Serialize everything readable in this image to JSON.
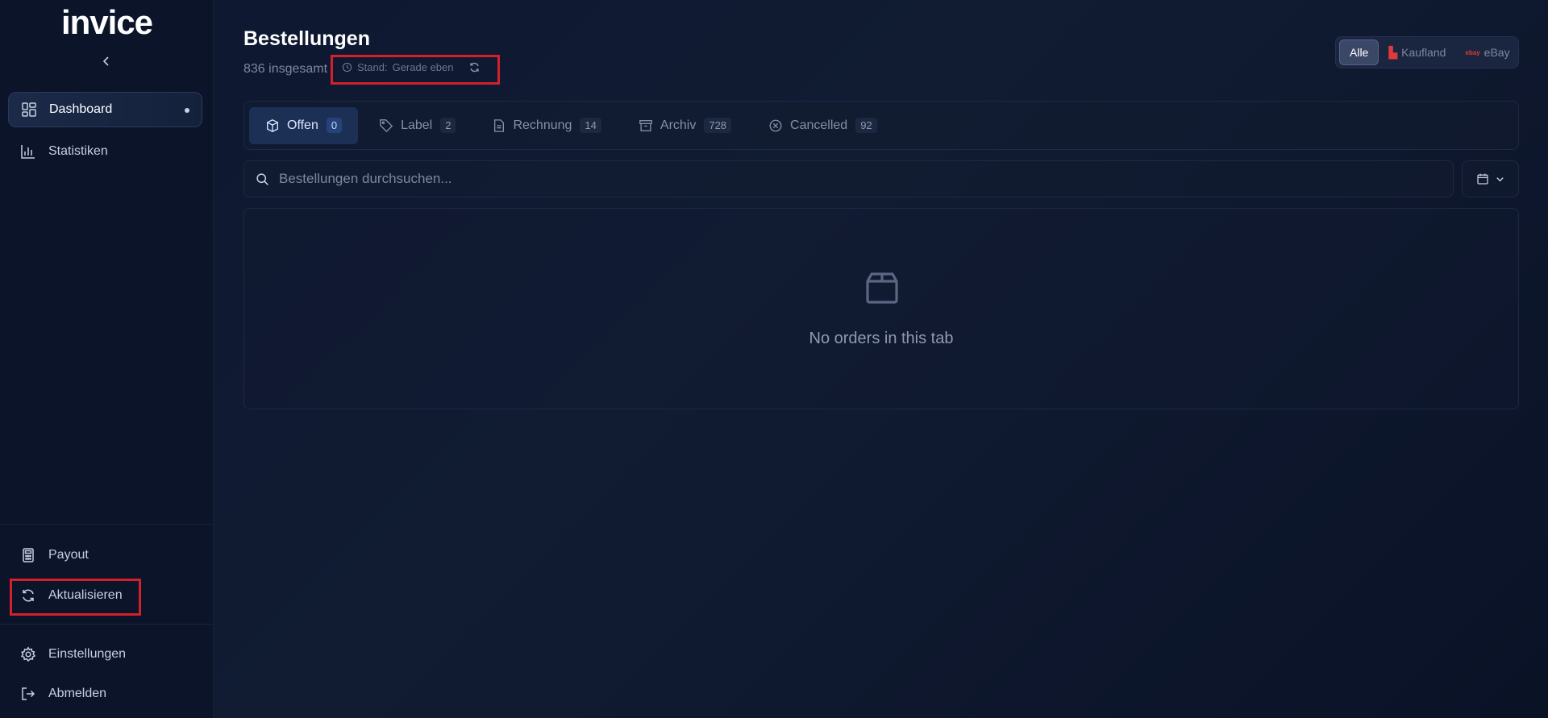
{
  "app": {
    "logo": "invice"
  },
  "sidebar": {
    "items": [
      {
        "label": "Dashboard",
        "icon": "dashboard-icon",
        "active": true
      },
      {
        "label": "Statistiken",
        "icon": "bar-chart-icon"
      }
    ],
    "bottom_items": [
      {
        "label": "Payout",
        "icon": "calculator-icon"
      },
      {
        "label": "Aktualisieren",
        "icon": "refresh-icon"
      },
      {
        "label": "Einstellungen",
        "icon": "gear-icon"
      },
      {
        "label": "Abmelden",
        "icon": "logout-icon"
      }
    ]
  },
  "header": {
    "title": "Bestellungen",
    "subtitle": "836 insgesamt",
    "stand_label": "Stand:",
    "stand_value": "Gerade eben"
  },
  "marketplace": {
    "options": [
      {
        "label": "Alle",
        "selected": true
      },
      {
        "label": "Kaufland",
        "icon": "kaufland-icon"
      },
      {
        "label": "eBay",
        "icon": "ebay-icon"
      }
    ]
  },
  "tabs": [
    {
      "label": "Offen",
      "count": "0",
      "icon": "box-icon",
      "active": true
    },
    {
      "label": "Label",
      "count": "2",
      "icon": "tag-icon"
    },
    {
      "label": "Rechnung",
      "count": "14",
      "icon": "document-icon"
    },
    {
      "label": "Archiv",
      "count": "728",
      "icon": "archive-icon"
    },
    {
      "label": "Cancelled",
      "count": "92",
      "icon": "x-circle-icon"
    }
  ],
  "search": {
    "placeholder": "Bestellungen durchsuchen..."
  },
  "empty_state": {
    "message": "No orders in this tab"
  },
  "colors": {
    "accent": "#1c3056",
    "highlight": "#d3202a",
    "background": "#0d1730"
  }
}
